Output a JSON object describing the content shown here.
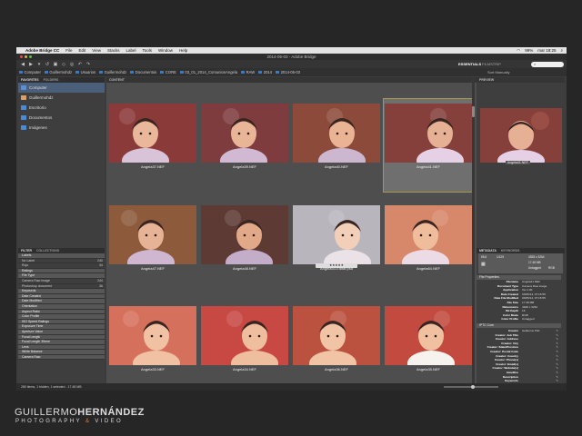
{
  "menubar": {
    "app_name": "Adobe Bridge CC",
    "items": [
      "File",
      "Edit",
      "View",
      "Stacks",
      "Label",
      "Tools",
      "Window",
      "Help"
    ],
    "clock": "mar 18:25",
    "battery": "99%"
  },
  "window": {
    "title": "2014-05-03 - Adobe Bridge"
  },
  "toolbar": {
    "workspace_active": "ESSENTIALS",
    "workspace_menu": "FILMSTRIP",
    "search_placeholder": ""
  },
  "path": {
    "segments": [
      "Computer",
      "Guillermohdz",
      "Usuarios",
      "Guillermohdz",
      "Documentos",
      "CORE",
      "03_01_2014_ComunionAngela",
      "RAW",
      "2014",
      "2014-05-03"
    ],
    "sort_label": "Sort Manually"
  },
  "left_panel": {
    "tabs": [
      "FAVORITES",
      "FOLDERS"
    ],
    "favorites": [
      {
        "label": "Computer",
        "icon": "computer-icon",
        "color": "#5a8fd6"
      },
      {
        "label": "Guillermohdz",
        "icon": "user-icon",
        "color": "#d9a06b"
      },
      {
        "label": "Escritorio",
        "icon": "folder-icon",
        "color": "#4a8ad6"
      },
      {
        "label": "Documentos",
        "icon": "folder-icon",
        "color": "#4a8ad6"
      },
      {
        "label": "Imágenes",
        "icon": "folder-icon",
        "color": "#4a8ad6"
      }
    ],
    "filter_tabs": [
      "FILTER",
      "COLLECTIONS"
    ],
    "filter_rows": [
      {
        "label": "Labels",
        "count": "",
        "type": "hdr"
      },
      {
        "label": "No Label",
        "count": "240",
        "type": "row"
      },
      {
        "label": "Rojo",
        "count": "34",
        "type": "row"
      },
      {
        "label": "Ratings",
        "count": "",
        "type": "hdr"
      },
      {
        "label": "File Type",
        "count": "",
        "type": "hdr"
      },
      {
        "label": "Camera Raw image",
        "count": "244",
        "type": "row"
      },
      {
        "label": "Photoshop document",
        "count": "36",
        "type": "row"
      },
      {
        "label": "Keywords",
        "count": "",
        "type": "hdr"
      },
      {
        "label": "Date Created",
        "count": "",
        "type": "hdr"
      },
      {
        "label": "Date Modified",
        "count": "",
        "type": "hdr"
      },
      {
        "label": "Orientation",
        "count": "",
        "type": "hdr"
      },
      {
        "label": "Aspect Ratio",
        "count": "",
        "type": "hdr"
      },
      {
        "label": "Color Profile",
        "count": "",
        "type": "hdr"
      },
      {
        "label": "ISO Speed Ratings",
        "count": "",
        "type": "hdr"
      },
      {
        "label": "Exposure Time",
        "count": "",
        "type": "hdr"
      },
      {
        "label": "Aperture Value",
        "count": "",
        "type": "hdr"
      },
      {
        "label": "Focal Length",
        "count": "",
        "type": "hdr"
      },
      {
        "label": "Focal Length 35mm",
        "count": "",
        "type": "hdr"
      },
      {
        "label": "Lens",
        "count": "",
        "type": "hdr"
      },
      {
        "label": "White Balance",
        "count": "",
        "type": "hdr"
      },
      {
        "label": "Camera Raw",
        "count": "",
        "type": "hdr"
      }
    ]
  },
  "content": {
    "tab": "CONTENT",
    "rating_overlay": "★★★★★",
    "thumbs": [
      {
        "name": "Angela37.NEF",
        "bg": "#8a3a38",
        "skin": "#e9b89a",
        "shirt": "#d8c3d9",
        "selected": false,
        "rated": false
      },
      {
        "name": "Angela39.NEF",
        "bg": "#7e3c3e",
        "skin": "#e8b596",
        "shirt": "#d2b9d3",
        "selected": false,
        "rated": false
      },
      {
        "name": "Angela40.NEF",
        "bg": "#8c4a3a",
        "skin": "#eab494",
        "shirt": "#cdb6d0",
        "selected": false,
        "rated": false
      },
      {
        "name": "Angela41.NEF",
        "bg": "#85403c",
        "skin": "#e6b094",
        "shirt": "#e6d0e6",
        "selected": true,
        "rated": false
      },
      {
        "name": "Angela47.NEF",
        "bg": "#8d5a3c",
        "skin": "#e6b396",
        "shirt": "#cfb6d1",
        "selected": false,
        "rated": false
      },
      {
        "name": "Angela48.NEF",
        "bg": "#5e3a34",
        "skin": "#e1a988",
        "shirt": "#c4adc9",
        "selected": false,
        "rated": false
      },
      {
        "name": "Angela53-Editar.psd",
        "bg": "#b9b5bd",
        "skin": "#f1cfb8",
        "shirt": "#eae2e6",
        "selected": false,
        "rated": true
      },
      {
        "name": "Angela64.NEF",
        "bg": "#d8886a",
        "skin": "#f0bd9c",
        "shirt": "#ecdbe4",
        "selected": false,
        "rated": false
      },
      {
        "name": "Angela33.NEF",
        "bg": "#d5705c",
        "skin": "#f0c1a3",
        "shirt": "#f0c1a3",
        "selected": false,
        "rated": false
      },
      {
        "name": "Angela34.NEF",
        "bg": "#c84844",
        "skin": "#efbe9e",
        "shirt": "#efbe9e",
        "selected": false,
        "rated": false
      },
      {
        "name": "Angela36.NEF",
        "bg": "#bb5240",
        "skin": "#f2c4a6",
        "shirt": "#f2c4a6",
        "selected": false,
        "rated": false
      },
      {
        "name": "Angela35.NEF",
        "bg": "#c24a3e",
        "skin": "#f0c0a0",
        "shirt": "#f6f2ee",
        "selected": false,
        "rated": false
      }
    ]
  },
  "right_panel": {
    "tab": "PREVIEW",
    "preview_caption": "Angela41.NEF",
    "meta_tabs": [
      "METADATA",
      "KEYWORDS"
    ],
    "meta_box": [
      "f/5.6",
      "1/125",
      "4928 x 3264",
      "17.48 MB",
      "Untagged",
      "RGB"
    ],
    "file_props_title": "File Properties",
    "file_props": [
      [
        "Filename",
        "Angela41.NEF"
      ],
      [
        "Document Type",
        "Camera Raw image"
      ],
      [
        "Application",
        "Ver.1.00"
      ],
      [
        "Date Created",
        "03/05/14, 07:15:55"
      ],
      [
        "Date File Modified",
        "03/05/14, 07:15:55"
      ],
      [
        "File Size",
        "17.48 MB"
      ],
      [
        "Dimensions",
        "4928 x 3264"
      ],
      [
        "Bit Depth",
        "16"
      ],
      [
        "Color Mode",
        "RGB"
      ],
      [
        "Color Profile",
        "Untagged"
      ]
    ],
    "iptc_title": "IPTC Core",
    "iptc": [
      [
        "Creator",
        "Guillermo Hdz"
      ],
      [
        "Creator: Job Title",
        ""
      ],
      [
        "Creator: Address",
        ""
      ],
      [
        "Creator: City",
        ""
      ],
      [
        "Creator: State/Province",
        ""
      ],
      [
        "Creator: Postal Code",
        ""
      ],
      [
        "Creator: Country",
        ""
      ],
      [
        "Creator: Phone(s)",
        ""
      ],
      [
        "Creator: Email(s)",
        ""
      ],
      [
        "Creator: Website(s)",
        ""
      ],
      [
        "Headline",
        ""
      ],
      [
        "Description",
        ""
      ],
      [
        "Keywords",
        ""
      ],
      [
        "IPTC Subject Code",
        ""
      ],
      [
        "Description Writer",
        ""
      ],
      [
        "Date Created",
        "03/05/14, 07:15:55"
      ]
    ]
  },
  "statusbar": {
    "text": "280 items, 1 hidden, 1 selected - 17.48 MB"
  },
  "watermark": {
    "line1_light": "GUILLERMO",
    "line1_bold": "HERNÁNDEZ",
    "line2_a": "PHOTOGRAPHY",
    "line2_amp": "&",
    "line2_b": "VIDEO"
  }
}
